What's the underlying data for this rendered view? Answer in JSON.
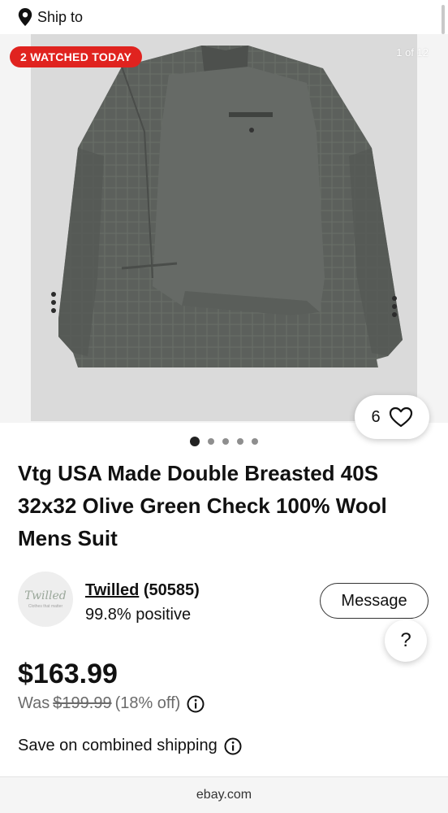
{
  "header": {
    "ship_to_label": "Ship to"
  },
  "gallery": {
    "badge": "2 WATCHED TODAY",
    "counter": "1 of 12",
    "watch_count": "6",
    "dots_total": 5,
    "dots_active_index": 0
  },
  "listing": {
    "title": "Vtg USA Made Double Breasted 40S 32x32 Olive Green Check 100% Wool Mens Suit"
  },
  "seller": {
    "avatar_logo": "Twilled",
    "avatar_tagline": "Clothes that matter",
    "name": "Twilled",
    "feedback_count": "(50585)",
    "positive": "99.8% positive",
    "message_button": "Message"
  },
  "help": {
    "label": "?"
  },
  "pricing": {
    "price": "$163.99",
    "was_label": "Was",
    "was_price": "$199.99",
    "discount": "(18% off)"
  },
  "shipping": {
    "label": "Save on combined shipping"
  },
  "footer": {
    "domain": "ebay.com"
  },
  "colors": {
    "badge_bg": "#e0231f",
    "text": "#111111",
    "muted": "#6b6b6b"
  }
}
